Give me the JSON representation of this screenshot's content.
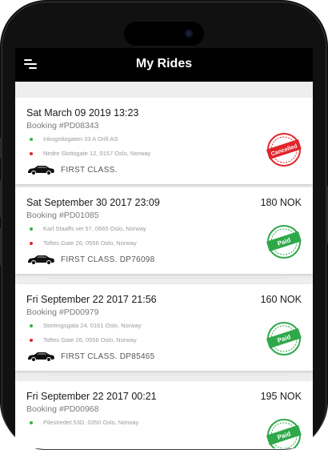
{
  "header": {
    "title": "My Rides"
  },
  "rides": [
    {
      "date": "Sat March 09 2019 13:23",
      "price": "",
      "booking": "Booking #PD08343",
      "pickup": "Inkognitogaten 33 A Drift AS",
      "dropoff": "Nedre Slottsgate 12, 0157 Oslo, Norway",
      "class": "FIRST CLASS.",
      "status": "Cancelled",
      "status_color": "#e0262b"
    },
    {
      "date": "Sat September 30 2017 23:09",
      "price": "180 NOK",
      "booking": "Booking #PD01085",
      "pickup": "Karl Staaffs vei 57, 0665 Oslo, Norway",
      "dropoff": "Toftes Gate 26, 0556 Oslo, Norway",
      "class": "FIRST CLASS. DP76098",
      "status": "Paid",
      "status_color": "#2fa84a"
    },
    {
      "date": "Fri September 22 2017 21:56",
      "price": "160 NOK",
      "booking": "Booking #PD00979",
      "pickup": "Stortingsgata 24, 0161 Oslo, Norway",
      "dropoff": "Toftes Gate 26, 0556 Oslo, Norway",
      "class": "FIRST CLASS. DP85465",
      "status": "Paid",
      "status_color": "#2fa84a"
    },
    {
      "date": "Fri September 22 2017 00:21",
      "price": "195 NOK",
      "booking": "Booking #PD00968",
      "pickup": "Pilestredet 53D, 0350 Oslo, Norway",
      "dropoff": "",
      "class": "",
      "status": "Paid",
      "status_color": "#2fa84a"
    }
  ],
  "colors": {
    "pickup_dot": "#35b44a",
    "dropoff_dot": "#e0262b",
    "header_bg": "#000000"
  },
  "icons": {
    "menu": "hamburger-icon",
    "car": "car-icon",
    "stamp": "status-stamp-icon"
  }
}
